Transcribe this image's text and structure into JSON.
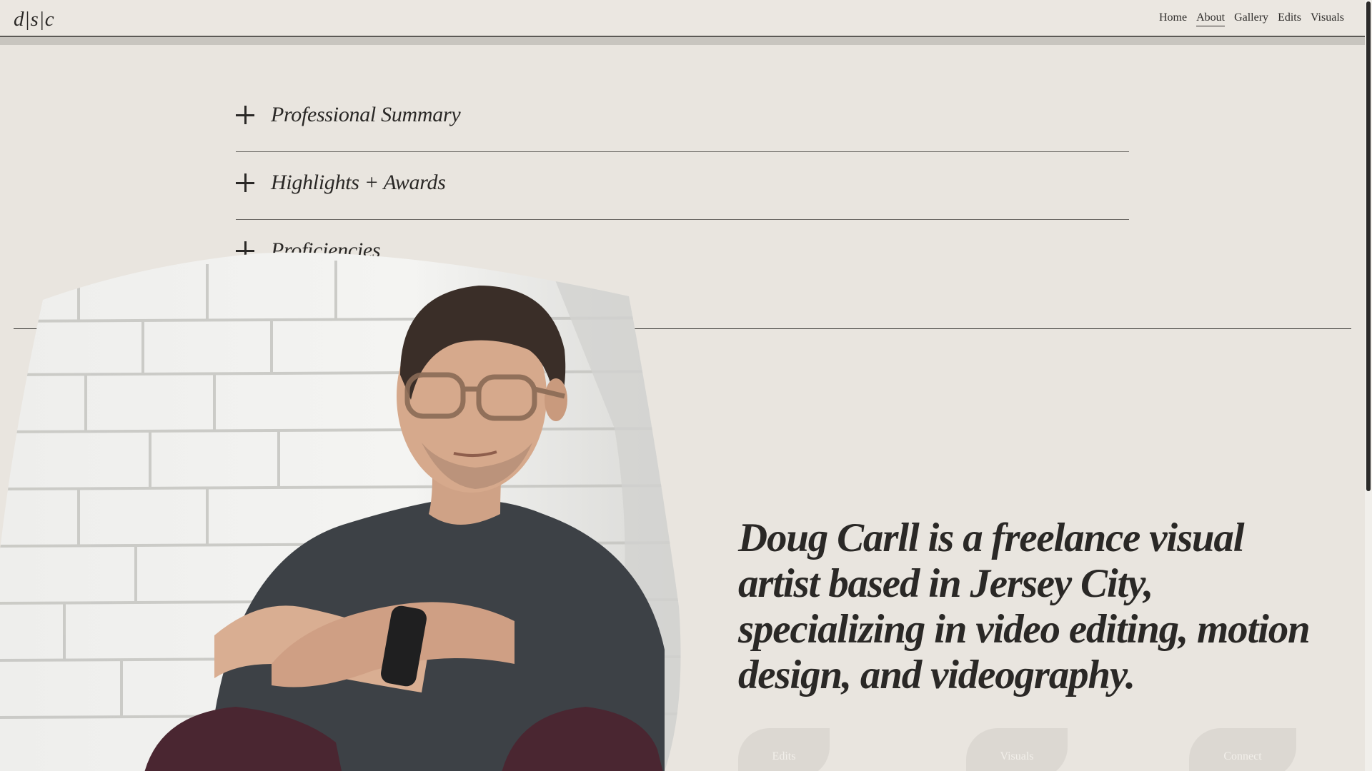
{
  "header": {
    "logo": "d|s|c",
    "nav": [
      {
        "label": "Home",
        "active": false
      },
      {
        "label": "About",
        "active": true
      },
      {
        "label": "Gallery",
        "active": false
      },
      {
        "label": "Edits",
        "active": false
      },
      {
        "label": "Visuals",
        "active": false
      }
    ]
  },
  "accordion": {
    "items": [
      {
        "label": "Professional Summary",
        "expanded": false
      },
      {
        "label": "Highlights + Awards",
        "expanded": false
      },
      {
        "label": "Proficiencies",
        "expanded": false
      }
    ]
  },
  "hero": {
    "text": "Doug Carll is a freelance visual artist based in Jersey City, specializing in video editing, motion design, and videography."
  },
  "buttons": {
    "edits": "Edits",
    "visuals": "Visuals",
    "connect": "Connect"
  },
  "colors": {
    "background": "#e9e5df",
    "text": "#2a2826",
    "accent_blob": "#dcd8d2"
  }
}
